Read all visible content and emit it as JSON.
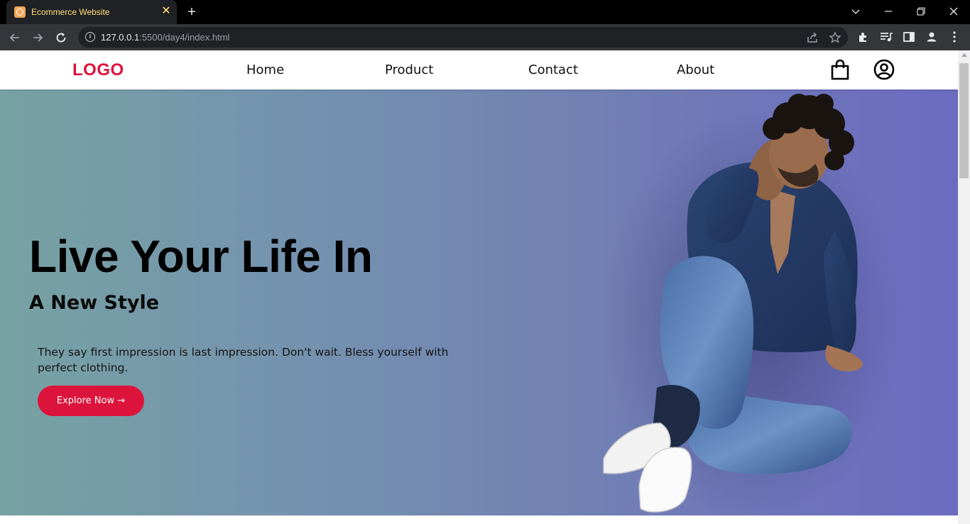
{
  "browser": {
    "tab_title": "Ecommerce Website",
    "tab_close": "✕",
    "new_tab": "+",
    "url_host": "127.0.0.1",
    "url_rest": ":5500/day4/index.html"
  },
  "header": {
    "logo": "LOGO",
    "nav": [
      "Home",
      "Product",
      "Contact",
      "About"
    ]
  },
  "hero": {
    "title": "Live Your Life In",
    "subtitle": "A New Style",
    "description": "They say first impression is last impression. Don't wait. Bless yourself with perfect clothing.",
    "button": "Explore Now →"
  },
  "colors": {
    "brand": "#dc143c",
    "hero_gradient_start": "#77a2a3",
    "hero_gradient_end": "#6c6bc1"
  }
}
